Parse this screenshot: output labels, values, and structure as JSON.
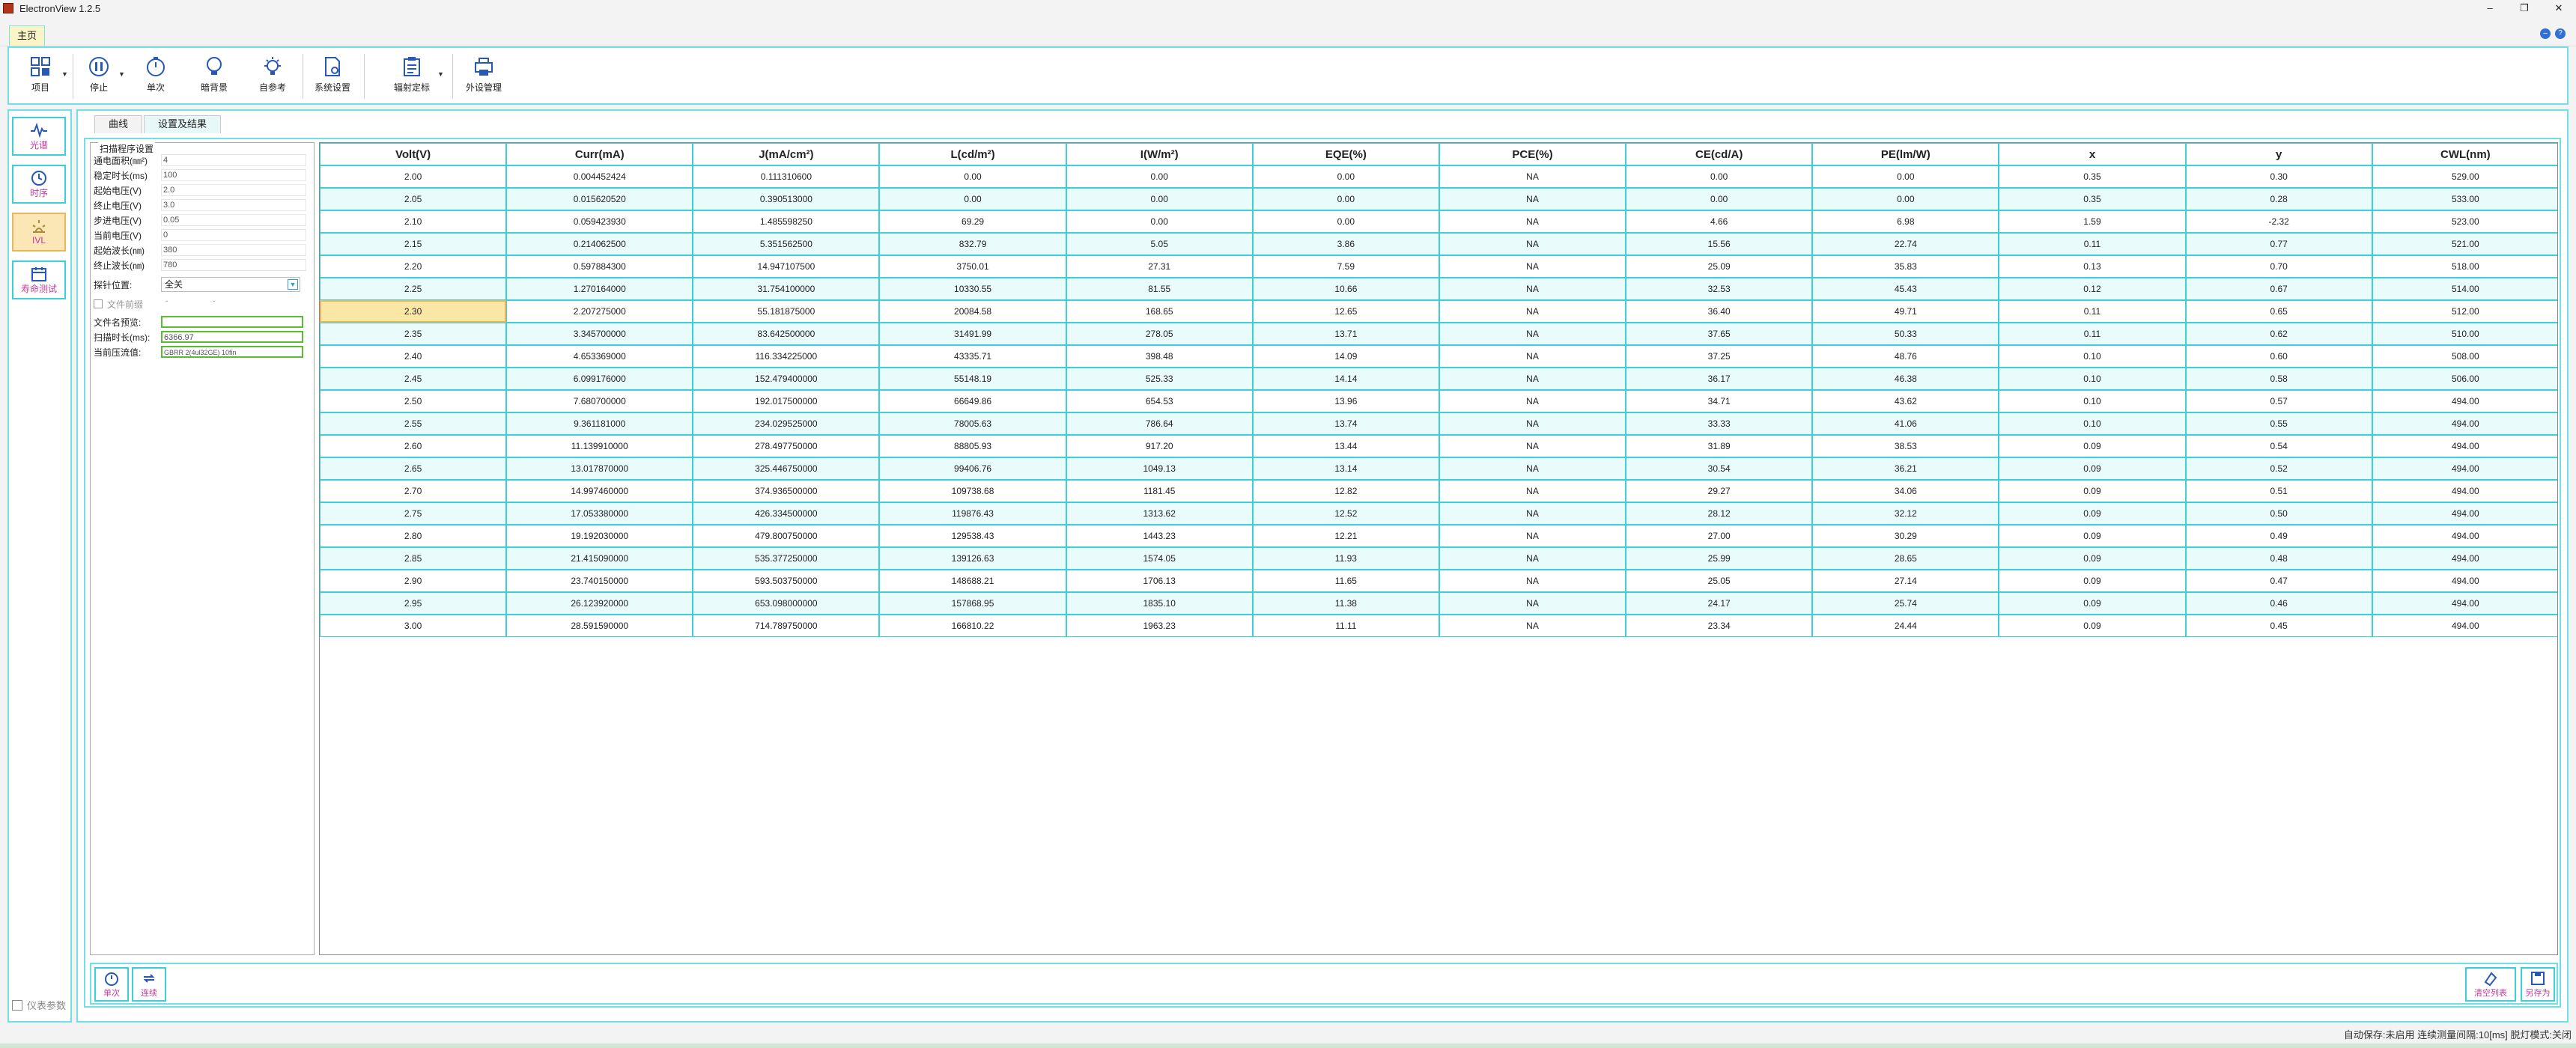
{
  "app": {
    "title": "ElectronView 1.2.5"
  },
  "menu": {
    "home_tab": "主页"
  },
  "toolbar": {
    "project": "项目",
    "stop": "停止",
    "single": "单次",
    "dark_bg": "暗背景",
    "self_ref": "自参考",
    "system_settings": "系统设置",
    "radiometric_cal": "辐射定标",
    "peripheral_mgmt": "外设管理"
  },
  "sidebar": {
    "spectrum": "光谱",
    "timing": "时序",
    "ivl": "IVL",
    "lifetime": "寿命测试",
    "instrument_params": "仪表参数"
  },
  "tabs": {
    "curve": "曲线",
    "settings_results": "设置及结果"
  },
  "settings": {
    "legend": "扫描程序设置",
    "rows": [
      {
        "label": "通电面积(㎜²)",
        "value": "4"
      },
      {
        "label": "稳定时长(ms)",
        "value": "100"
      },
      {
        "label": "起始电压(V)",
        "value": "2.0"
      },
      {
        "label": "终止电压(V)",
        "value": "3.0"
      },
      {
        "label": "步进电压(V)",
        "value": "0.05"
      },
      {
        "label": "当前电压(V)",
        "value": "0"
      },
      {
        "label": "起始波长(㎚)",
        "value": "380"
      },
      {
        "label": "终止波长(㎚)",
        "value": "780"
      }
    ],
    "probe_label": "探针位置:",
    "probe_value": "全关",
    "file_prefix": "文件前缀",
    "filename_label": "文件名预览:",
    "filename_value": "",
    "scan_time_label": "扫描时长(ms):",
    "scan_time_value": "6366.97",
    "current_limit_label": "当前压流值:",
    "current_limit_value": "GBRR 2(4ul32GE) 10fin"
  },
  "table": {
    "headers": [
      "Volt(V)",
      "Curr(mA)",
      "J(mA/cm²)",
      "L(cd/m²)",
      "I(W/m²)",
      "EQE(%)",
      "PCE(%)",
      "CE(cd/A)",
      "PE(lm/W)",
      "x",
      "y",
      "CWL(nm)"
    ],
    "rows": [
      [
        "2.00",
        "0.004452424",
        "0.111310600",
        "0.00",
        "0.00",
        "0.00",
        "NA",
        "0.00",
        "0.00",
        "0.35",
        "0.30",
        "529.00"
      ],
      [
        "2.05",
        "0.015620520",
        "0.390513000",
        "0.00",
        "0.00",
        "0.00",
        "NA",
        "0.00",
        "0.00",
        "0.35",
        "0.28",
        "533.00"
      ],
      [
        "2.10",
        "0.059423930",
        "1.485598250",
        "69.29",
        "0.00",
        "0.00",
        "NA",
        "4.66",
        "6.98",
        "1.59",
        "-2.32",
        "523.00"
      ],
      [
        "2.15",
        "0.214062500",
        "5.351562500",
        "832.79",
        "5.05",
        "3.86",
        "NA",
        "15.56",
        "22.74",
        "0.11",
        "0.77",
        "521.00"
      ],
      [
        "2.20",
        "0.597884300",
        "14.947107500",
        "3750.01",
        "27.31",
        "7.59",
        "NA",
        "25.09",
        "35.83",
        "0.13",
        "0.70",
        "518.00"
      ],
      [
        "2.25",
        "1.270164000",
        "31.754100000",
        "10330.55",
        "81.55",
        "10.66",
        "NA",
        "32.53",
        "45.43",
        "0.12",
        "0.67",
        "514.00"
      ],
      [
        "2.30",
        "2.207275000",
        "55.181875000",
        "20084.58",
        "168.65",
        "12.65",
        "NA",
        "36.40",
        "49.71",
        "0.11",
        "0.65",
        "512.00"
      ],
      [
        "2.35",
        "3.345700000",
        "83.642500000",
        "31491.99",
        "278.05",
        "13.71",
        "NA",
        "37.65",
        "50.33",
        "0.11",
        "0.62",
        "510.00"
      ],
      [
        "2.40",
        "4.653369000",
        "116.334225000",
        "43335.71",
        "398.48",
        "14.09",
        "NA",
        "37.25",
        "48.76",
        "0.10",
        "0.60",
        "508.00"
      ],
      [
        "2.45",
        "6.099176000",
        "152.479400000",
        "55148.19",
        "525.33",
        "14.14",
        "NA",
        "36.17",
        "46.38",
        "0.10",
        "0.58",
        "506.00"
      ],
      [
        "2.50",
        "7.680700000",
        "192.017500000",
        "66649.86",
        "654.53",
        "13.96",
        "NA",
        "34.71",
        "43.62",
        "0.10",
        "0.57",
        "494.00"
      ],
      [
        "2.55",
        "9.361181000",
        "234.029525000",
        "78005.63",
        "786.64",
        "13.74",
        "NA",
        "33.33",
        "41.06",
        "0.10",
        "0.55",
        "494.00"
      ],
      [
        "2.60",
        "11.139910000",
        "278.497750000",
        "88805.93",
        "917.20",
        "13.44",
        "NA",
        "31.89",
        "38.53",
        "0.09",
        "0.54",
        "494.00"
      ],
      [
        "2.65",
        "13.017870000",
        "325.446750000",
        "99406.76",
        "1049.13",
        "13.14",
        "NA",
        "30.54",
        "36.21",
        "0.09",
        "0.52",
        "494.00"
      ],
      [
        "2.70",
        "14.997460000",
        "374.936500000",
        "109738.68",
        "1181.45",
        "12.82",
        "NA",
        "29.27",
        "34.06",
        "0.09",
        "0.51",
        "494.00"
      ],
      [
        "2.75",
        "17.053380000",
        "426.334500000",
        "119876.43",
        "1313.62",
        "12.52",
        "NA",
        "28.12",
        "32.12",
        "0.09",
        "0.50",
        "494.00"
      ],
      [
        "2.80",
        "19.192030000",
        "479.800750000",
        "129538.43",
        "1443.23",
        "12.21",
        "NA",
        "27.00",
        "30.29",
        "0.09",
        "0.49",
        "494.00"
      ],
      [
        "2.85",
        "21.415090000",
        "535.377250000",
        "139126.63",
        "1574.05",
        "11.93",
        "NA",
        "25.99",
        "28.65",
        "0.09",
        "0.48",
        "494.00"
      ],
      [
        "2.90",
        "23.740150000",
        "593.503750000",
        "148688.21",
        "1706.13",
        "11.65",
        "NA",
        "25.05",
        "27.14",
        "0.09",
        "0.47",
        "494.00"
      ],
      [
        "2.95",
        "26.123920000",
        "653.098000000",
        "157868.95",
        "1835.10",
        "11.38",
        "NA",
        "24.17",
        "25.74",
        "0.09",
        "0.46",
        "494.00"
      ],
      [
        "3.00",
        "28.591590000",
        "714.789750000",
        "166810.22",
        "1963.23",
        "11.11",
        "NA",
        "23.34",
        "24.44",
        "0.09",
        "0.45",
        "494.00"
      ]
    ],
    "selected_row": 6
  },
  "footer": {
    "single": "单次",
    "continuous": "连续",
    "clear_list": "清空列表",
    "save_as": "另存为"
  },
  "status": {
    "text": "自动保存:未启用   连续测量间隔:10[ms]   脱灯模式:关闭"
  }
}
